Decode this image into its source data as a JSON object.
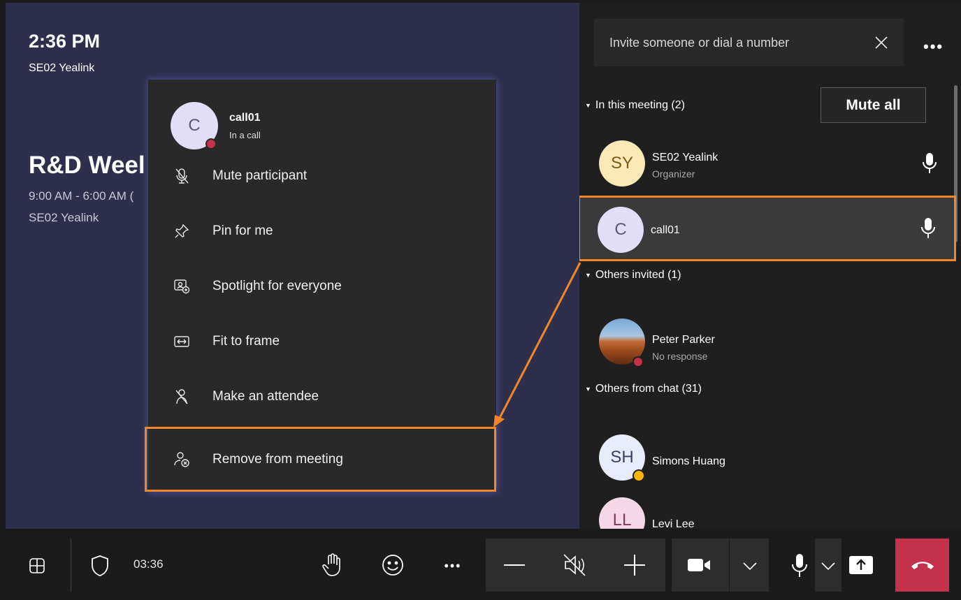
{
  "stage": {
    "clock": "2:36 PM",
    "room": "SE02 Yealink",
    "meeting_title": "R&D Weel",
    "meeting_time": "9:00 AM - 6:00 AM (",
    "meeting_organizer": "SE02 Yealink"
  },
  "context_menu": {
    "avatar_initial": "C",
    "name": "call01",
    "status": "In a call",
    "items": [
      {
        "label": "Mute participant",
        "icon": "mic-off-icon"
      },
      {
        "label": "Pin for me",
        "icon": "pin-icon"
      },
      {
        "label": "Spotlight for everyone",
        "icon": "spotlight-icon"
      },
      {
        "label": "Fit to frame",
        "icon": "fit-frame-icon"
      },
      {
        "label": "Make an attendee",
        "icon": "attendee-icon"
      },
      {
        "label": "Remove from meeting",
        "icon": "remove-person-icon",
        "highlighted": true
      }
    ]
  },
  "panel": {
    "invite_placeholder": "Invite someone or dial a number",
    "more_label": "•••",
    "in_meeting_header": "In this meeting (2)",
    "mute_all": "Mute all",
    "others_invited_header": "Others invited (1)",
    "others_chat_header": "Others from chat (31)",
    "participants": [
      {
        "initials": "SY",
        "name": "SE02 Yealink",
        "role": "Organizer"
      },
      {
        "initials": "C",
        "name": "call01",
        "role": ""
      }
    ],
    "invited": [
      {
        "name": "Peter Parker",
        "role": "No response"
      }
    ],
    "chat": [
      {
        "initials": "SH",
        "name": "Simons Huang"
      },
      {
        "initials": "LL",
        "name": "Levi Lee"
      }
    ]
  },
  "toolbar": {
    "timer": "03:36",
    "more_label": "•••"
  },
  "colors": {
    "stage_bg": "#2e2f4d",
    "highlight": "#f5852a",
    "hangup": "#c4314b",
    "busy": "#c4314b",
    "away": "#f8b600"
  }
}
